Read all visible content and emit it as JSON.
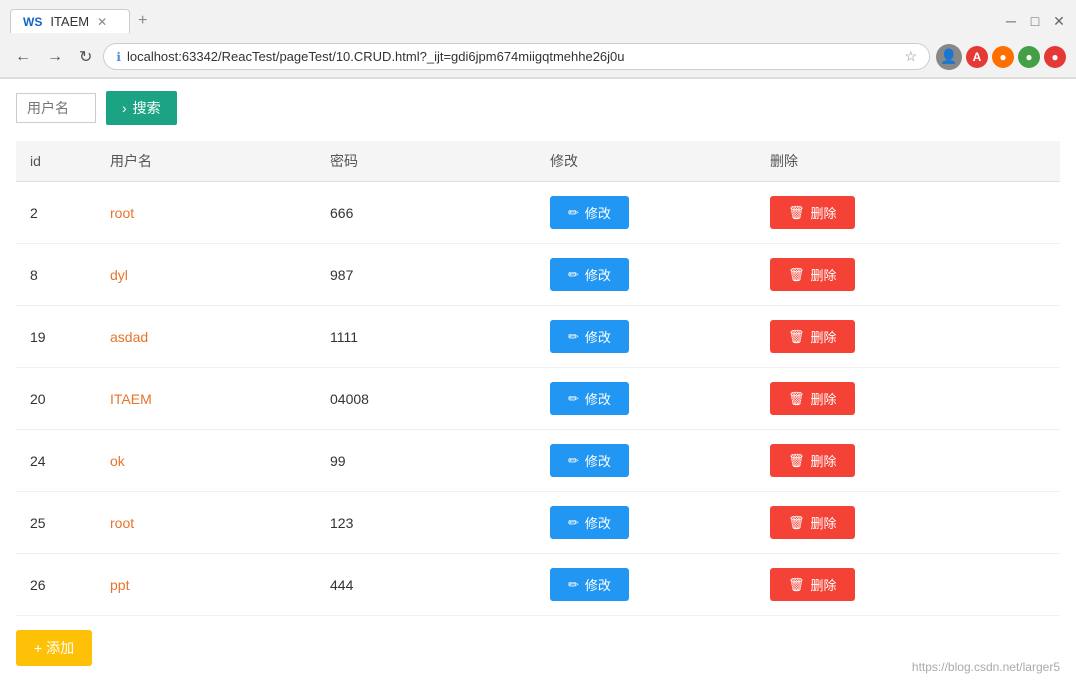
{
  "browser": {
    "tab_title": "ITAEM",
    "address": "localhost:63342/ReacTest/pageTest/10.CRUD.html?_ijt=gdi6jpm674miigqtmehhe26j0u"
  },
  "toolbar": {
    "username_placeholder": "用户名",
    "search_label": "搜索"
  },
  "table": {
    "headers": [
      "id",
      "用户名",
      "密码",
      "修改",
      "删除"
    ],
    "rows": [
      {
        "id": "2",
        "username": "root",
        "password": "666"
      },
      {
        "id": "8",
        "username": "dyl",
        "password": "987"
      },
      {
        "id": "19",
        "username": "asdad",
        "password": "1111"
      },
      {
        "id": "20",
        "username": "ITAEM",
        "password": "04008"
      },
      {
        "id": "24",
        "username": "ok",
        "password": "99"
      },
      {
        "id": "25",
        "username": "root",
        "password": "123"
      },
      {
        "id": "26",
        "username": "ppt",
        "password": "444"
      }
    ],
    "edit_label": "✏ 修改",
    "delete_label": "🗑 删除"
  },
  "add_button_label": "+ 添加",
  "watermark": "https://blog.csdn.net/larger5"
}
